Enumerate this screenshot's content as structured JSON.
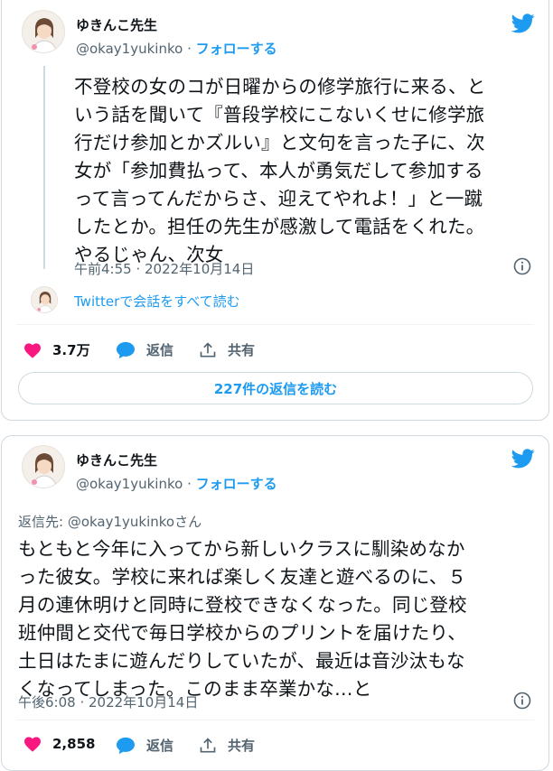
{
  "tweets": [
    {
      "author": {
        "name": "ゆきんこ先生",
        "handle": "@okay1yukinko",
        "separator": "·",
        "follow_label": "フォローする"
      },
      "text": "不登校の女のコが日曜からの修学旅行に来る、と\nいう話を聞いて『普段学校にこないくせに修学旅\n行だけ参加とかズルい』と文句を言った子に、次\n女が「参加費払って、本人が勇気だして参加する\nって言ってんだからさ、迎えてやれよ！」と一蹴\nしたとか。担任の先生が感激して電話をくれた。\nやるじゃん、次女",
      "timestamp": "午前4:55 · 2022年10月14日",
      "conversation_link": "Twitterで会話をすべて読む",
      "likes": "3.7万",
      "reply_label": "返信",
      "share_label": "共有",
      "read_replies": "227件の返信を読む"
    },
    {
      "author": {
        "name": "ゆきんこ先生",
        "handle": "@okay1yukinko",
        "separator": "·",
        "follow_label": "フォローする"
      },
      "replying_to": "返信先: @okay1yukinkoさん",
      "text": "もともと今年に入ってから新しいクラスに馴染めなか\nった彼女。学校に来れば楽しく友達と遊べるのに、５\n月の連休明けと同時に登校できなくなった。同じ登校\n班仲間と交代で毎日学校からのプリントを届けたり、\n土日はたまに遊んだりしていたが、最近は音沙汰もな\nくなってしまった。このまま卒業かな…と",
      "timestamp": "午後6:08 · 2022年10月14日",
      "likes": "2,858",
      "reply_label": "返信",
      "share_label": "共有"
    }
  ],
  "colors": {
    "accent": "#1d9bf0",
    "like": "#f91880",
    "secondary_text": "#536471",
    "border": "#cfd9de"
  },
  "icons": [
    "twitter-bird-icon",
    "heart-icon",
    "reply-bubble-icon",
    "share-icon",
    "info-icon"
  ]
}
